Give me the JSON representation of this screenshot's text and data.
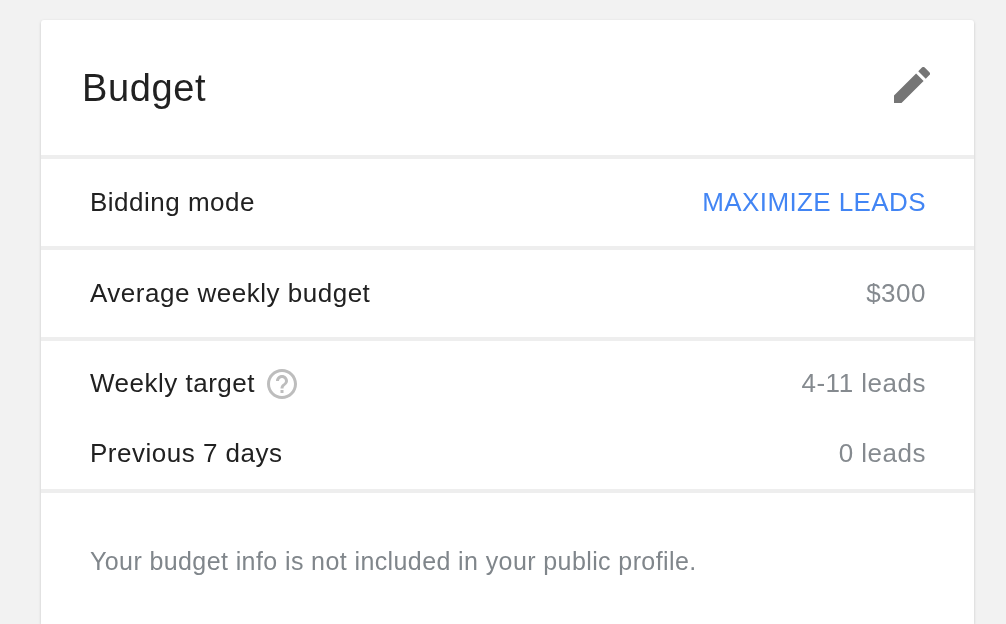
{
  "card": {
    "title": "Budget",
    "sections": [
      {
        "rows": [
          {
            "label": "Bidding mode",
            "value": "MAXIMIZE LEADS",
            "kind": "link",
            "help": false
          }
        ]
      },
      {
        "rows": [
          {
            "label": "Average weekly budget",
            "value": "$300",
            "kind": "text",
            "help": false
          }
        ]
      },
      {
        "rows": [
          {
            "label": "Weekly target",
            "value": "4-11 leads",
            "kind": "text",
            "help": true
          },
          {
            "label": "Previous 7 days",
            "value": "0 leads",
            "kind": "text",
            "help": false
          }
        ]
      }
    ],
    "note": "Your budget info is not included in your public profile."
  }
}
